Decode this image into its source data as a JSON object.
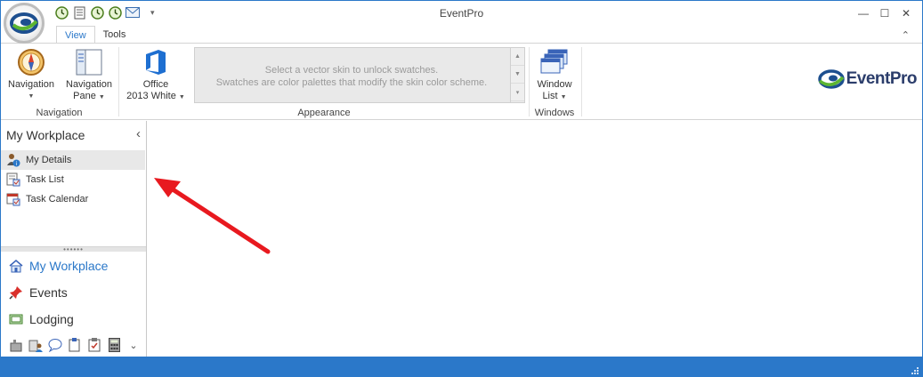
{
  "window": {
    "title": "EventPro"
  },
  "quick_access": [
    {
      "icon": "green-clock-icon"
    },
    {
      "icon": "document-icon"
    },
    {
      "icon": "green-clock-icon"
    },
    {
      "icon": "green-clock-icon"
    },
    {
      "icon": "mail-icon"
    }
  ],
  "tabs": [
    {
      "label": "View",
      "active": true
    },
    {
      "label": "Tools",
      "active": false
    }
  ],
  "ribbon": {
    "groups": {
      "navigation": "Navigation",
      "appearance": "Appearance",
      "windows": "Windows"
    },
    "buttons": {
      "navigation_line1": "Navigation",
      "nav_pane_line1": "Navigation",
      "nav_pane_line2": "Pane",
      "office_line1": "Office",
      "office_line2": "2013 White",
      "window_list_line1": "Window",
      "window_list_line2": "List"
    },
    "gallery_message_1": "Select a vector skin to unlock swatches.",
    "gallery_message_2": "Swatches are color palettes that modify the skin color scheme."
  },
  "brand": {
    "name": "EventPro"
  },
  "nav_pane": {
    "header": "My Workplace",
    "items": [
      {
        "label": "My Details",
        "selected": true
      },
      {
        "label": "Task List",
        "selected": false
      },
      {
        "label": "Task Calendar",
        "selected": false
      }
    ],
    "big_buttons": [
      {
        "label": "My Workplace",
        "active": true
      },
      {
        "label": "Events",
        "active": false
      },
      {
        "label": "Lodging",
        "active": false
      }
    ]
  },
  "colors": {
    "accent": "#2b78c9",
    "arrow": "#e8191f",
    "statusbar": "#2b78c9"
  }
}
